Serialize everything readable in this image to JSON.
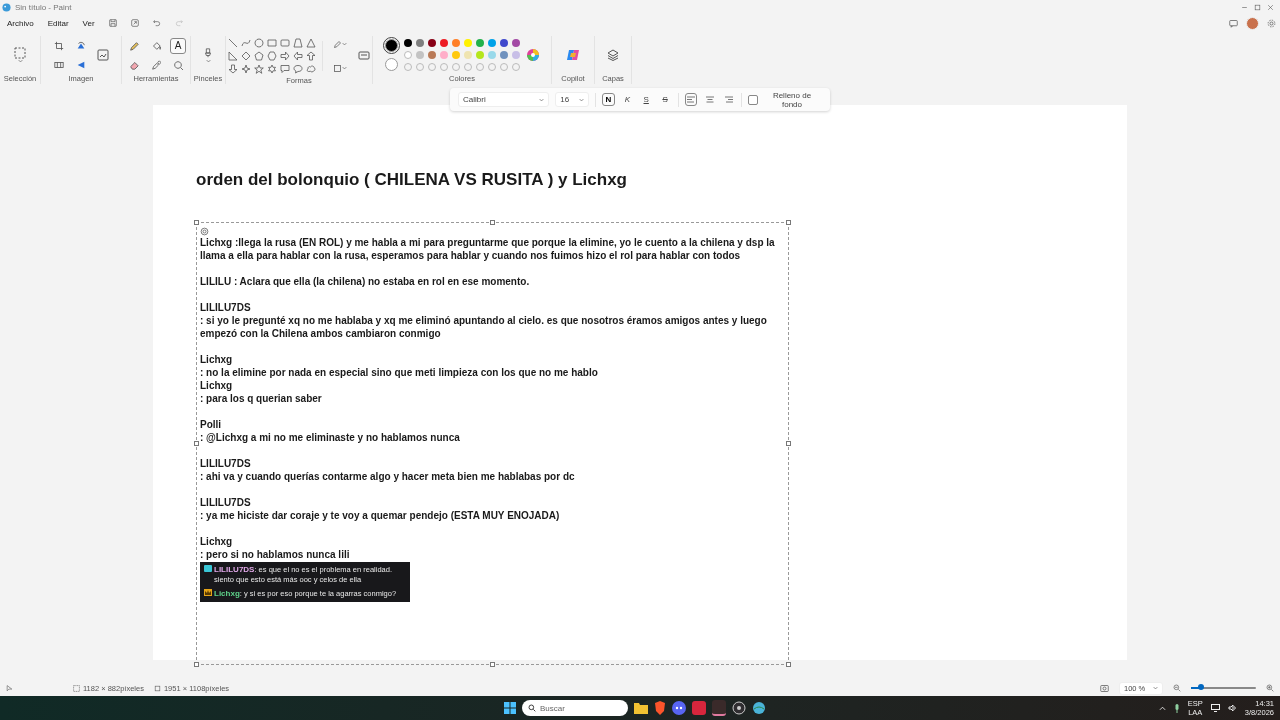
{
  "window": {
    "title": "Sin título - Paint"
  },
  "menu": [
    "Archivo",
    "Editar",
    "Ver"
  ],
  "ribbon": {
    "groups": [
      {
        "kind": "selection",
        "label": "Selección"
      },
      {
        "kind": "image",
        "label": "Imagen"
      },
      {
        "kind": "tools",
        "label": "Herramientas"
      },
      {
        "kind": "brushes",
        "label": "Pinceles"
      },
      {
        "kind": "shapes",
        "label": "Formas"
      },
      {
        "kind": "colors",
        "label": "Colores"
      },
      {
        "kind": "copilot",
        "label": "Copilot"
      },
      {
        "kind": "layers",
        "label": "Capas"
      }
    ],
    "tools": [
      {
        "kind": "pencil",
        "selected": false
      },
      {
        "kind": "fill",
        "selected": false
      },
      {
        "kind": "text",
        "label": "A",
        "selected": true
      },
      {
        "kind": "eraser",
        "selected": false
      },
      {
        "kind": "picker",
        "selected": false
      },
      {
        "kind": "magnifier",
        "selected": false
      }
    ],
    "palette": [
      {
        "color": "#000000",
        "primary": true
      },
      {
        "color": "#7f7f7f"
      },
      {
        "color": "#880015"
      },
      {
        "color": "#ed1c24"
      },
      {
        "color": "#ff7f27"
      },
      {
        "color": "#fff200"
      },
      {
        "color": "#22b14c"
      },
      {
        "color": "#00a2e8"
      },
      {
        "color": "#3f48cc"
      },
      {
        "color": "#a349a4"
      },
      {
        "color": "#ffffff",
        "secondary": true
      },
      {
        "color": "#c3c3c3"
      },
      {
        "color": "#b97a57"
      },
      {
        "color": "#ffaec9"
      },
      {
        "color": "#ffc90e"
      },
      {
        "color": "#efe4b0"
      },
      {
        "color": "#b5e61d"
      },
      {
        "color": "#99d9ea"
      },
      {
        "color": "#7092be"
      },
      {
        "color": "#c8bfe7"
      }
    ]
  },
  "text_toolbar": {
    "font": "Calibri",
    "size": "16",
    "format": [
      {
        "kind": "bold",
        "label": "N",
        "selected": true
      },
      {
        "kind": "italic",
        "label": "K",
        "selected": false
      },
      {
        "kind": "underline",
        "label": "S",
        "selected": false
      },
      {
        "kind": "strike",
        "label": "S",
        "selected": false
      }
    ],
    "alignment": [
      {
        "kind": "left",
        "selected": true
      },
      {
        "kind": "center",
        "selected": false
      },
      {
        "kind": "right",
        "selected": false
      }
    ],
    "fill_background": {
      "label": "Relleno de fondo",
      "checked": false
    }
  },
  "canvas": {
    "heading": "orden del bolonquio ( CHILENA VS RUSITA ) y Lichxg",
    "blocks": [
      {
        "lines": [
          "Lichxg :llega la rusa (EN ROL) y me habla a mi para preguntarme que porque la elimine, yo le cuento a la chilena y dsp la llama a ella para hablar con la rusa, esperamos para hablar y cuando nos fuimos hizo el rol para hablar con todos"
        ]
      },
      {
        "lines": [
          "LILILU : Aclara que ella (la chilena) no estaba en rol en ese momento."
        ]
      },
      {
        "lines": [
          "LILILU7DS",
          ": si yo le pregunté xq no me hablaba y xq me eliminó apuntando al cielo. es que nosotros éramos amigos antes y luego empezó con la Chilena ambos cambiaron conmigo"
        ]
      },
      {
        "lines": [
          "Lichxg",
          ": no la elimine por nada en especial sino que meti limpieza con los que no me hablo",
          "Lichxg",
          ": para los q querian saber"
        ]
      },
      {
        "lines": [
          "Polli",
          ": @Lichxg a mi no me eliminaste y no hablamos nunca"
        ]
      },
      {
        "lines": [
          "LILILU7DS",
          ": ahi va y cuando querías contarme algo y hacer meta bien me hablabas por dc"
        ]
      },
      {
        "lines": [
          "LILILU7DS",
          ": ya me hiciste dar coraje y te voy a quemar pendejo  (ESTA MUY ENOJADA)"
        ]
      },
      {
        "lines": [
          "Lichxg",
          ": pero si no hablamos nunca lili"
        ]
      }
    ],
    "chat_image": {
      "messages": [
        {
          "kind": "square",
          "user": "LILILU7DS",
          "color": "#e0a8e8",
          "text": ": es que el no es el problema en realidad. siento que esto está más ooc y celos de ella"
        },
        {
          "kind": "crown",
          "user": "Lichxg",
          "color": "#5fd38a",
          "text": ": y si es por eso porque te la agarras conmigo?"
        }
      ]
    }
  },
  "status_bar": {
    "selection_size": "1182 × 882píxeles",
    "canvas_size": "1951 × 1108píxeles",
    "zoom": "100 %",
    "zoom_slider": {
      "level": 0.15
    }
  },
  "taskbar": {
    "search_placeholder": "Buscar",
    "language": "ESP",
    "layout": "LAA",
    "time": "14:31",
    "date": "3/8/2026"
  }
}
